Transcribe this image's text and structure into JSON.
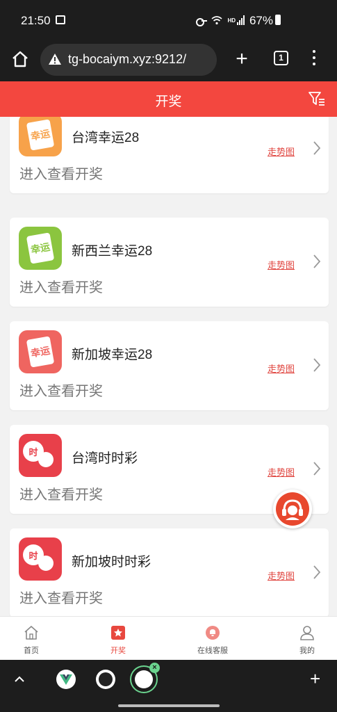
{
  "status_bar": {
    "time": "21:50",
    "network": "HD",
    "battery": "67%"
  },
  "browser": {
    "url": "tg-bocaiym.xyz:9212/",
    "tab_count": "1"
  },
  "header": {
    "title": "开奖"
  },
  "lottery_list": [
    {
      "name": "台湾幸运28",
      "subtitle": "进入查看开奖",
      "trend_label": "走势图",
      "icon": "ticket-icon",
      "icon_text": "幸运",
      "icon_color": "#f7a24a"
    },
    {
      "name": "新西兰幸运28",
      "subtitle": "进入查看开奖",
      "trend_label": "走势图",
      "icon": "ticket-icon",
      "icon_text": "幸运",
      "icon_color": "#8bc53f"
    },
    {
      "name": "新加坡幸运28",
      "subtitle": "进入查看开奖",
      "trend_label": "走势图",
      "icon": "ticket-icon",
      "icon_text": "幸运",
      "icon_color": "#ef6560"
    },
    {
      "name": "台湾时时彩",
      "subtitle": "进入查看开奖",
      "trend_label": "走势图",
      "icon": "ball-icon",
      "icon_text": "时",
      "icon_color": "#e8404a"
    },
    {
      "name": "新加坡时时彩",
      "subtitle": "进入查看开奖",
      "trend_label": "走势图",
      "icon": "ball-icon",
      "icon_text": "时",
      "icon_color": "#e8404a"
    }
  ],
  "bottom_nav": [
    {
      "label": "首页",
      "icon": "home-icon",
      "active": false
    },
    {
      "label": "开奖",
      "icon": "lottery-icon",
      "active": true
    },
    {
      "label": "在线客服",
      "icon": "support-icon",
      "active": false
    },
    {
      "label": "我的",
      "icon": "user-icon",
      "active": false
    }
  ],
  "colors": {
    "accent": "#f3473f",
    "trend_link": "#e0453f"
  }
}
